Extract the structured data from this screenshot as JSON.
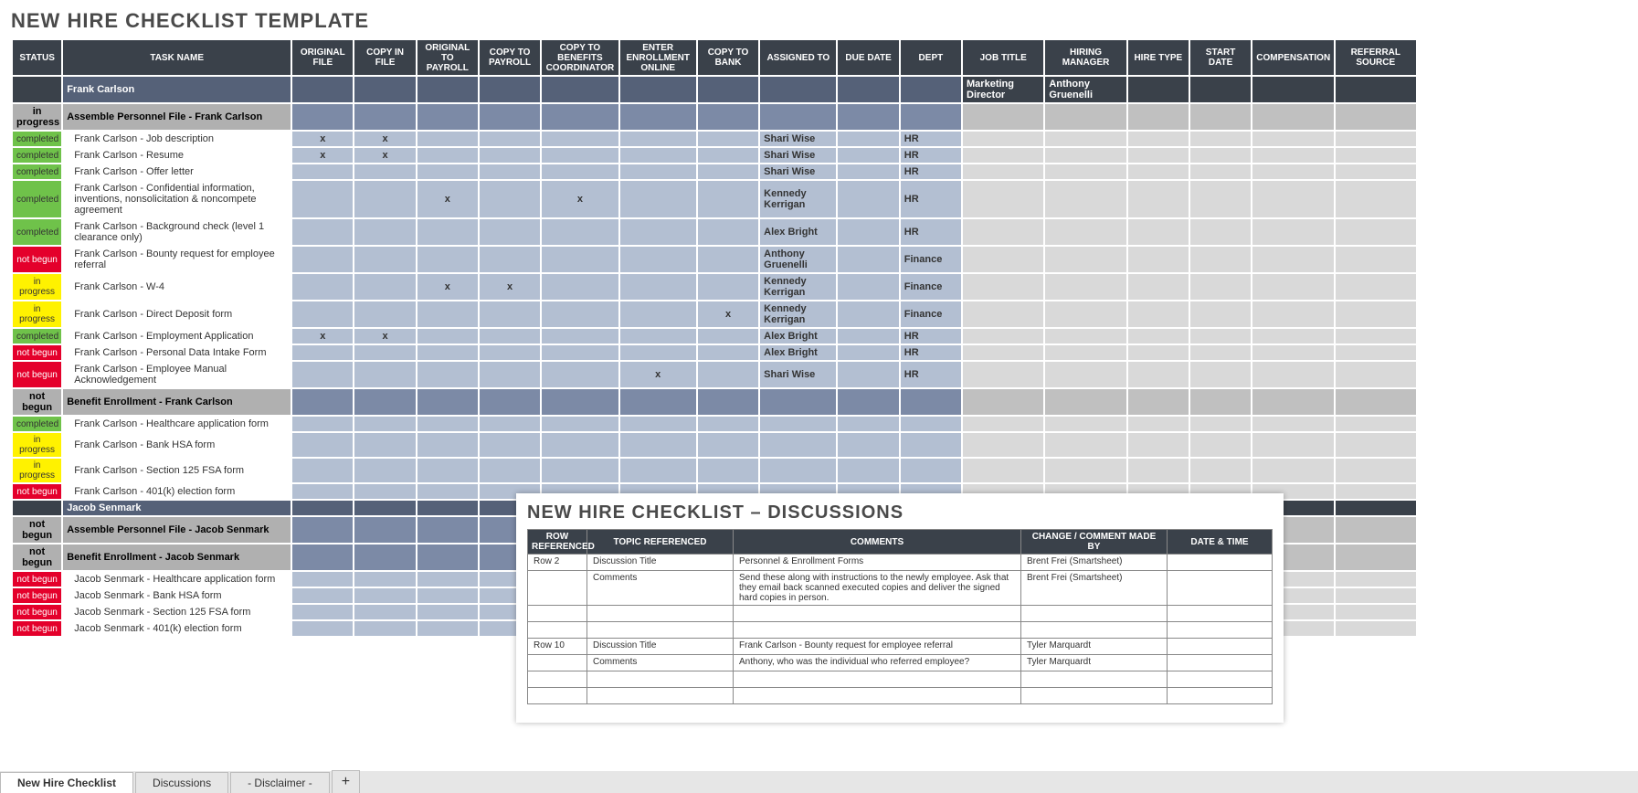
{
  "title": "NEW HIRE CHECKLIST TEMPLATE",
  "columns": [
    "STATUS",
    "TASK NAME",
    "ORIGINAL FILE",
    "COPY IN FILE",
    "ORIGINAL TO PAYROLL",
    "COPY TO PAYROLL",
    "COPY TO BENEFITS COORDINATOR",
    "ENTER ENROLLMENT ONLINE",
    "COPY TO BANK",
    "ASSIGNED TO",
    "DUE DATE",
    "DEPT",
    "JOB TITLE",
    "HIRING MANAGER",
    "HIRE TYPE",
    "START DATE",
    "COMPENSATION",
    "REFERRAL SOURCE"
  ],
  "rows": [
    {
      "type": "section",
      "name": "Frank Carlson",
      "job": "Marketing Director",
      "hm": "Anthony Gruenelli"
    },
    {
      "type": "group",
      "status": "in progress",
      "name": "Assemble Personnel File - Frank Carlson"
    },
    {
      "type": "data",
      "status": "completed",
      "name": "Frank Carlson - Job description",
      "m": [
        "x",
        "x",
        "",
        "",
        "",
        "",
        "",
        ""
      ],
      "assigned": "Shari Wise",
      "dept": "HR"
    },
    {
      "type": "data",
      "status": "completed",
      "name": "Frank Carlson - Resume",
      "m": [
        "x",
        "x",
        "",
        "",
        "",
        "",
        "",
        ""
      ],
      "assigned": "Shari Wise",
      "dept": "HR"
    },
    {
      "type": "data",
      "status": "completed",
      "name": "Frank Carlson - Offer letter",
      "m": [
        "",
        "",
        "",
        "",
        "",
        "",
        "",
        ""
      ],
      "assigned": "Shari Wise",
      "dept": "HR"
    },
    {
      "type": "data",
      "status": "completed",
      "name": "Frank Carlson - Confidential information, inventions, nonsolicitation & noncompete agreement",
      "m": [
        "",
        "",
        "x",
        "",
        "x",
        "",
        "",
        ""
      ],
      "assigned": "Kennedy Kerrigan",
      "dept": "HR"
    },
    {
      "type": "data",
      "status": "completed",
      "name": "Frank Carlson - Background check (level 1 clearance only)",
      "m": [
        "",
        "",
        "",
        "",
        "",
        "",
        "",
        ""
      ],
      "assigned": "Alex Bright",
      "dept": "HR"
    },
    {
      "type": "data",
      "status": "not begun",
      "name": "Frank Carlson - Bounty request for employee referral",
      "m": [
        "",
        "",
        "",
        "",
        "",
        "",
        "",
        ""
      ],
      "assigned": "Anthony Gruenelli",
      "dept": "Finance"
    },
    {
      "type": "data",
      "status": "in progress",
      "name": "Frank Carlson - W-4",
      "m": [
        "",
        "",
        "x",
        "x",
        "",
        "",
        "",
        ""
      ],
      "assigned": "Kennedy Kerrigan",
      "dept": "Finance"
    },
    {
      "type": "data",
      "status": "in progress",
      "name": "Frank Carlson - Direct Deposit form",
      "m": [
        "",
        "",
        "",
        "",
        "",
        "",
        "x",
        ""
      ],
      "assigned": "Kennedy Kerrigan",
      "dept": "Finance"
    },
    {
      "type": "data",
      "status": "completed",
      "name": "Frank Carlson - Employment Application",
      "m": [
        "x",
        "x",
        "",
        "",
        "",
        "",
        "",
        ""
      ],
      "assigned": "Alex Bright",
      "dept": "HR"
    },
    {
      "type": "data",
      "status": "not begun",
      "name": "Frank Carlson - Personal Data Intake Form",
      "m": [
        "",
        "",
        "",
        "",
        "",
        "",
        "",
        ""
      ],
      "assigned": "Alex Bright",
      "dept": "HR"
    },
    {
      "type": "data",
      "status": "not begun",
      "name": "Frank Carlson - Employee Manual Acknowledgement",
      "m": [
        "",
        "",
        "",
        "",
        "",
        "x",
        "",
        ""
      ],
      "assigned": "Shari Wise",
      "dept": "HR"
    },
    {
      "type": "group",
      "status": "not begun",
      "name": "Benefit Enrollment - Frank Carlson"
    },
    {
      "type": "data",
      "status": "completed",
      "name": "Frank Carlson - Healthcare application form",
      "m": [
        "",
        "",
        "",
        "",
        "",
        "",
        "",
        ""
      ],
      "assigned": "",
      "dept": ""
    },
    {
      "type": "data",
      "status": "in progress",
      "name": "Frank Carlson - Bank HSA form",
      "m": [
        "",
        "",
        "",
        "",
        "",
        "",
        "",
        ""
      ],
      "assigned": "",
      "dept": ""
    },
    {
      "type": "data",
      "status": "in progress",
      "name": "Frank Carlson - Section 125 FSA form",
      "m": [
        "",
        "",
        "",
        "",
        "",
        "",
        "",
        ""
      ],
      "assigned": "",
      "dept": ""
    },
    {
      "type": "data",
      "status": "not begun",
      "name": "Frank Carlson - 401(k) election form",
      "m": [
        "",
        "",
        "",
        "",
        "",
        "",
        "",
        ""
      ],
      "assigned": "",
      "dept": ""
    },
    {
      "type": "section",
      "name": "Jacob Senmark",
      "job": "",
      "hm": ""
    },
    {
      "type": "group",
      "status": "not begun",
      "name": "Assemble Personnel File - Jacob Senmark"
    },
    {
      "type": "group",
      "status": "not begun",
      "name": "Benefit Enrollment - Jacob Senmark"
    },
    {
      "type": "data",
      "status": "not begun",
      "name": "Jacob Senmark - Healthcare application form",
      "m": [
        "",
        "",
        "",
        "",
        "",
        "",
        "",
        ""
      ],
      "assigned": "",
      "dept": ""
    },
    {
      "type": "data",
      "status": "not begun",
      "name": "Jacob Senmark - Bank HSA form",
      "m": [
        "",
        "",
        "",
        "",
        "",
        "",
        "",
        ""
      ],
      "assigned": "",
      "dept": ""
    },
    {
      "type": "data",
      "status": "not begun",
      "name": "Jacob Senmark - Section 125 FSA form",
      "m": [
        "",
        "",
        "",
        "",
        "",
        "",
        "",
        ""
      ],
      "assigned": "",
      "dept": ""
    },
    {
      "type": "data",
      "status": "not begun",
      "name": "Jacob Senmark - 401(k) election form",
      "m": [
        "",
        "",
        "",
        "",
        "",
        "",
        "",
        ""
      ],
      "assigned": "",
      "dept": ""
    }
  ],
  "discussion": {
    "title": "NEW HIRE CHECKLIST  –  DISCUSSIONS",
    "cols": [
      "ROW REFERENCED",
      "TOPIC REFERENCED",
      "COMMENTS",
      "CHANGE / COMMENT MADE BY",
      "DATE & TIME"
    ],
    "rows": [
      [
        "Row 2",
        "Discussion Title",
        "Personnel & Enrollment Forms",
        "Brent Frei (Smartsheet)",
        ""
      ],
      [
        "",
        "Comments",
        "Send these along with instructions to the newly employee.  Ask that they email back scanned executed copies and deliver the signed hard copies in person.",
        "Brent Frei (Smartsheet)",
        ""
      ],
      [
        "",
        "",
        "",
        "",
        ""
      ],
      [
        "",
        "",
        "",
        "",
        ""
      ],
      [
        "Row 10",
        "Discussion Title",
        "Frank Carlson - Bounty request for employee referral",
        "Tyler Marquardt",
        ""
      ],
      [
        "",
        "Comments",
        "Anthony, who was the individual who referred employee?",
        "Tyler Marquardt",
        ""
      ],
      [
        "",
        "",
        "",
        "",
        ""
      ],
      [
        "",
        "",
        "",
        "",
        ""
      ]
    ]
  },
  "tabs": [
    "New Hire Checklist",
    "Discussions",
    "- Disclaimer -",
    "+"
  ]
}
